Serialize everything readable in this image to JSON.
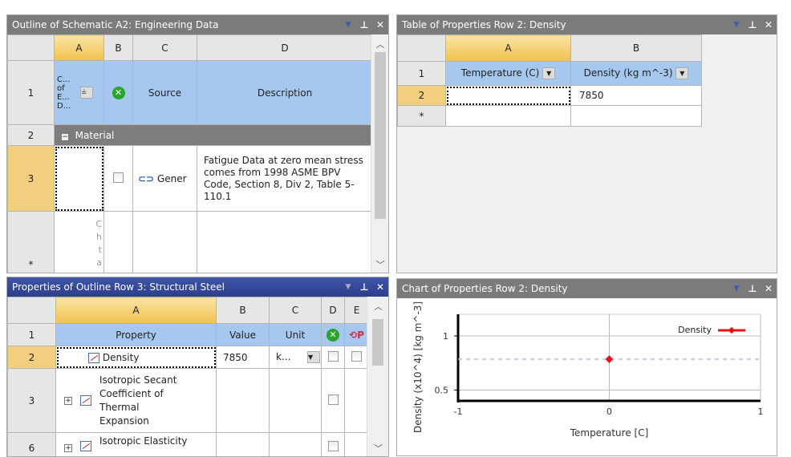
{
  "outline": {
    "title": "Outline of Schematic A2: Engineering Data",
    "columns": [
      "A",
      "B",
      "C",
      "D"
    ],
    "header_row": {
      "num": "1",
      "a": "C... of E... D...",
      "c": "Source",
      "d": "Description"
    },
    "group_row": {
      "num": "2",
      "label": "Material"
    },
    "row3": {
      "num": "3",
      "c": "Gener",
      "d": "Fatigue Data at zero mean stress comes from 1998 ASME BPV Code, Section 8, Div 2, Table 5-110.1"
    },
    "new_row": {
      "num": "*",
      "a": "C h t a"
    }
  },
  "table": {
    "title": "Table of Properties Row 2: Density",
    "columns": [
      "A",
      "B"
    ],
    "rows": [
      {
        "num": "1",
        "a": "Temperature (C)",
        "b": "Density (kg m^-3)"
      },
      {
        "num": "2",
        "a": "",
        "b": "7850"
      },
      {
        "num": "*",
        "a": "",
        "b": ""
      }
    ]
  },
  "properties": {
    "title": "Properties of Outline Row 3: Structural Steel",
    "columns": [
      "A",
      "B",
      "C",
      "D",
      "E"
    ],
    "header": {
      "num": "1",
      "a": "Property",
      "b": "Value",
      "c": "Unit"
    },
    "rows": [
      {
        "num": "2",
        "a": "Density",
        "b": "7850",
        "c": "k..."
      },
      {
        "num": "3",
        "a": "Isotropic Secant Coefficient of Thermal Expansion",
        "b": "",
        "c": ""
      },
      {
        "num": "6",
        "a": "Isotropic Elasticity",
        "b": "",
        "c": ""
      }
    ]
  },
  "chart": {
    "title": "Chart of Properties Row 2: Density"
  },
  "chart_data": {
    "type": "scatter",
    "xlabel": "Temperature [C]",
    "ylabel": "Density (x10^4) [kg m^-3]",
    "xlim": [
      -1,
      1
    ],
    "ylim": [
      0.4,
      1.2
    ],
    "xticks": [
      "-1",
      "0",
      "1"
    ],
    "yticks": [
      "0.5",
      "1"
    ],
    "series": [
      {
        "name": "Density",
        "x": [
          0
        ],
        "y": [
          0.785
        ],
        "color": "#e8141a"
      }
    ],
    "grid": true,
    "legend": "top-right"
  }
}
